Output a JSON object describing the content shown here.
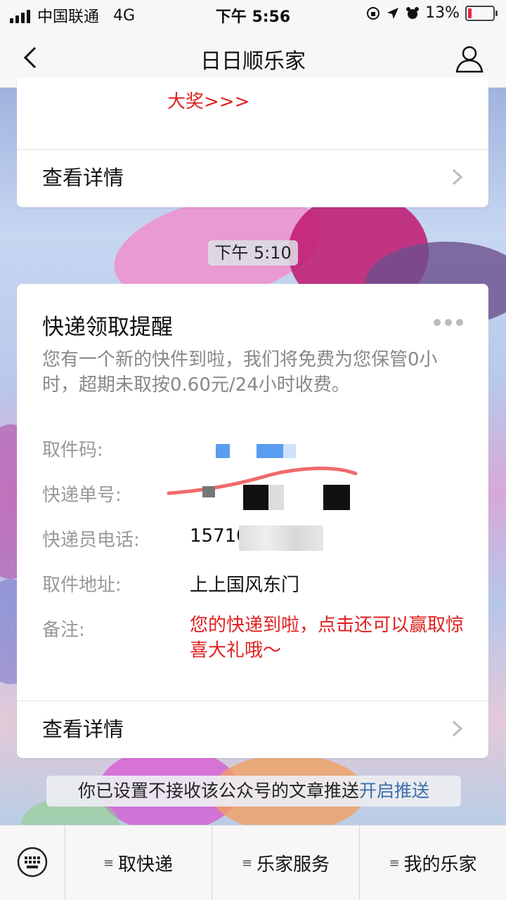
{
  "status_bar": {
    "carrier": "中国联通",
    "network": "4G",
    "time": "下午 5:56",
    "battery": "13%"
  },
  "nav": {
    "title": "日日顺乐家"
  },
  "previous_card": {
    "award_text": "大奖>>>",
    "detail_label": "查看详情"
  },
  "timestamp": "下午 5:10",
  "notice_card": {
    "title": "快递领取提醒",
    "description": "您有一个新的快件到啦，我们将免费为您保管0小时，超期未取按0.60元/24小时收费。",
    "fields": [
      {
        "label": "取件码:",
        "value": ""
      },
      {
        "label": "快递单号:",
        "value": ""
      },
      {
        "label": "快递员电话:",
        "value": "15710"
      },
      {
        "label": "取件地址:",
        "value": "上上国风东门"
      },
      {
        "label": "备注:",
        "value": "您的快递到啦，点击还可以赢取惊喜大礼哦～"
      }
    ],
    "detail_label": "查看详情"
  },
  "push_notice": {
    "text": "你已设置不接收该公众号的文章推送",
    "link": "开启推送"
  },
  "bottom_menu": {
    "items": [
      "取快递",
      "乐家服务",
      "我的乐家"
    ]
  },
  "colors": {
    "accent_red": "#e02020",
    "link_blue": "#3b6ea8"
  }
}
